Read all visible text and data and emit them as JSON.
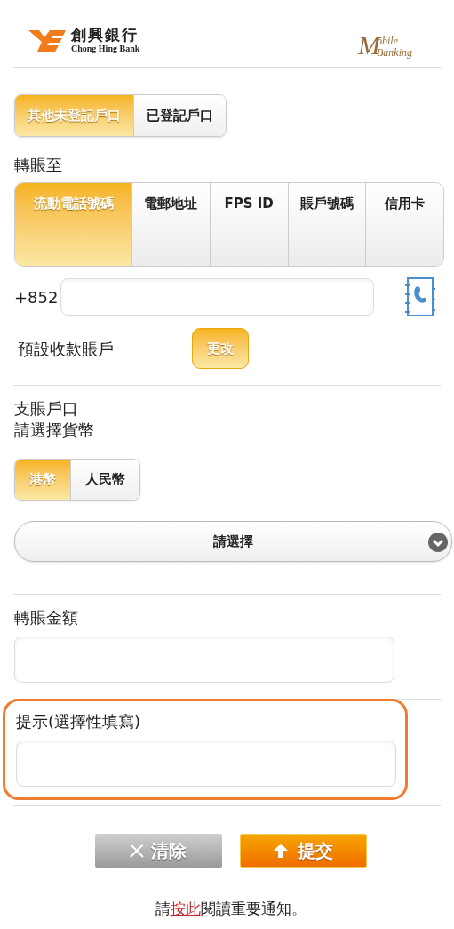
{
  "header": {
    "bank_name_zh": "創興銀行",
    "bank_name_en": "Chong Hing Bank",
    "app_logo": {
      "initial": "M",
      "line_1": "obile",
      "line_2": "Banking"
    }
  },
  "account_type_tabs": [
    {
      "label": "其他未登記戶口",
      "selected": true
    },
    {
      "label": "已登記戶口",
      "selected": false
    }
  ],
  "transfer_to": {
    "label": "轉賬至",
    "tabs": [
      {
        "label": "流動電話號碼",
        "selected": true
      },
      {
        "label": "電郵地址",
        "selected": false
      },
      {
        "label": "FPS ID",
        "selected": false
      },
      {
        "label": "賬戶號碼",
        "selected": false
      },
      {
        "label": "信用卡",
        "selected": false
      }
    ],
    "prefix": "+852",
    "default_account_label": "預設收款賬戶",
    "change_button": "更改"
  },
  "debit_account": {
    "label": "支賬戶口",
    "currency_label": "請選擇貨幣",
    "currency_tabs": [
      {
        "label": "港幣",
        "selected": true
      },
      {
        "label": "人民幣",
        "selected": false
      }
    ],
    "select": "請選擇"
  },
  "amount": {
    "label": "轉賬金額"
  },
  "remark": {
    "label": "提示(選擇性填寫)",
    "highlighted": true
  },
  "buttons": {
    "clear": "清除",
    "submit": "提交"
  },
  "notice": {
    "before": "請",
    "link": "按此",
    "after": "閱讀重要通知。"
  }
}
